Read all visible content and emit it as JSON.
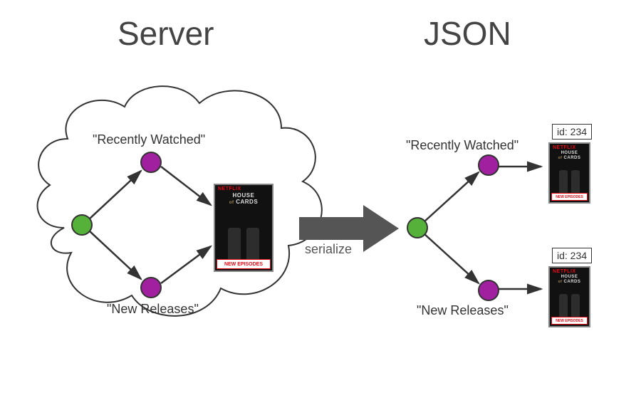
{
  "title_left": "Server",
  "title_right": "JSON",
  "graph_left": {
    "labels": {
      "top": "\"Recently Watched\"",
      "bottom": "\"New Releases\""
    }
  },
  "graph_right": {
    "labels": {
      "top": "\"Recently Watched\"",
      "bottom": "\"New Releases\""
    },
    "id_top": "id: 234",
    "id_bottom": "id: 234"
  },
  "arrow_label": "serialize",
  "poster": {
    "brand": "NETFLIX",
    "title_l1": "HOUSE",
    "title_of": "of",
    "title_l2": "CARDS",
    "tag": "NEW EPISODES"
  }
}
